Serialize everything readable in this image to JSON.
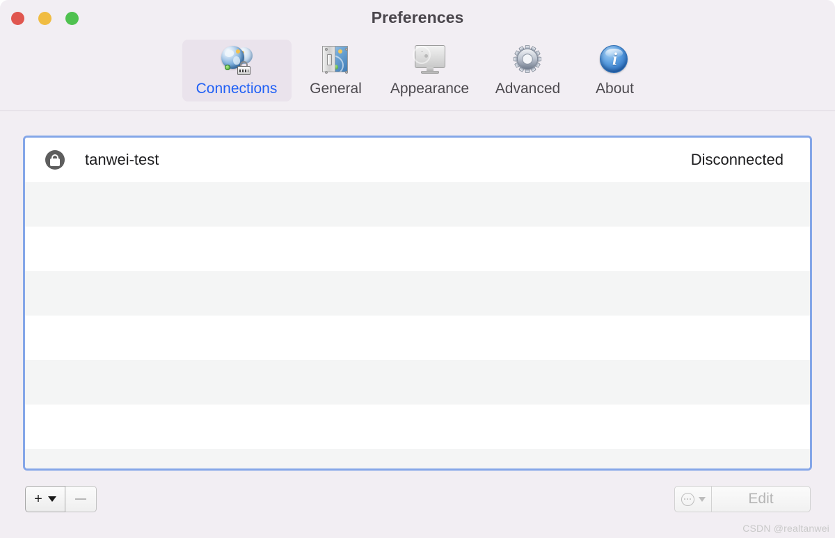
{
  "window": {
    "title": "Preferences",
    "traffic_lights": [
      {
        "name": "close",
        "color": "#e0564f"
      },
      {
        "name": "minimize",
        "color": "#f0bc42"
      },
      {
        "name": "zoom",
        "color": "#4fc14f"
      }
    ],
    "background": "#f2eef3"
  },
  "toolbar": {
    "selected": "Connections",
    "selected_color": "#2060f5",
    "selected_bg": "#eae3ec",
    "items": [
      {
        "label": "Connections",
        "icon": "globes-lock-icon",
        "selected": true
      },
      {
        "label": "General",
        "icon": "switch-plate-icon",
        "selected": false
      },
      {
        "label": "Appearance",
        "icon": "monitor-icon",
        "selected": false
      },
      {
        "label": "Advanced",
        "icon": "gear-icon",
        "selected": false
      },
      {
        "label": "About",
        "icon": "info-circle-icon",
        "selected": false
      }
    ]
  },
  "connections_table": {
    "focus_ring_color": "#84a6e8",
    "row_alt_color": "#f4f5f5",
    "rows": [
      {
        "lock_icon": "lock-icon",
        "name": "tanwei-test",
        "status": "Disconnected"
      },
      {
        "lock_icon": "",
        "name": "",
        "status": ""
      },
      {
        "lock_icon": "",
        "name": "",
        "status": ""
      },
      {
        "lock_icon": "",
        "name": "",
        "status": ""
      },
      {
        "lock_icon": "",
        "name": "",
        "status": ""
      },
      {
        "lock_icon": "",
        "name": "",
        "status": ""
      },
      {
        "lock_icon": "",
        "name": "",
        "status": ""
      },
      {
        "lock_icon": "",
        "name": "",
        "status": ""
      }
    ]
  },
  "footer": {
    "add_button": {
      "label": "+",
      "caret": "▼",
      "enabled": true
    },
    "remove_button": {
      "label": "−",
      "enabled": false
    },
    "action_button": {
      "label": "⋯",
      "caret": "▼",
      "enabled": false
    },
    "edit_button": {
      "label": "Edit",
      "enabled": false
    }
  },
  "watermark": {
    "text": "CSDN @realtanwei"
  }
}
